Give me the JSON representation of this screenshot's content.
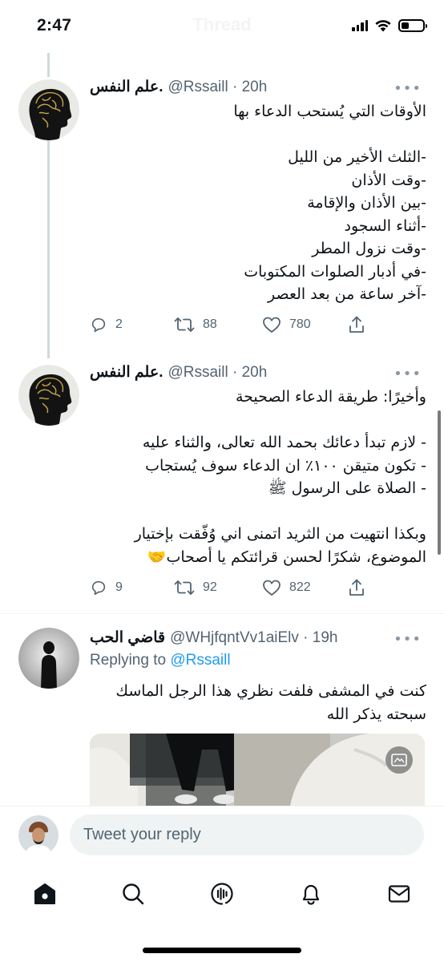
{
  "status_bar": {
    "time": "2:47",
    "ghost_title": "Thread"
  },
  "tweets": [
    {
      "display_name": "علم النفس.",
      "meta": "@Rssaill · 20h",
      "lines": [
        "الأوقات التي يُستحب الدعاء بها",
        "",
        "-الثلث الأخير من الليل",
        "-وقت الأذان",
        "-بين الأذان والإقامة",
        "-أثناء السجود",
        "-وقت نزول المطر",
        "-في أدبار الصلوات المكتوبات",
        "-آخر ساعة من بعد العصر"
      ],
      "replies": "2",
      "retweets": "88",
      "likes": "780"
    },
    {
      "display_name": "علم النفس.",
      "meta": "@Rssaill · 20h",
      "lines": [
        "وأخيرًا: طريقة الدعاء الصحيحة",
        "",
        "- لازم تبدأ دعائك بحمد الله تعالى، والثناء عليه",
        "- تكون متيقن ١٠٠٪ ان الدعاء سوف يُستجاب",
        "- الصلاة على الرسول ﷺ",
        "",
        "وبكذا انتهيت من الثريد اتمنى اني وُفّقت بإختيار",
        "الموضوع، شكرًا لحسن قرائتكم يا أصحاب🤝"
      ],
      "replies": "9",
      "retweets": "92",
      "likes": "822"
    },
    {
      "display_name": "قاضي الحب",
      "meta": "@WHjfqntVv1aiElv · 19h",
      "replying_prefix": "Replying to",
      "replying_handle": "@Rssaill",
      "lines": [
        "كنت في المشفى فلفت نظري هذا الرجل الماسك",
        "سبحته يذكر الله"
      ]
    }
  ],
  "composer": {
    "placeholder": "Tweet your reply"
  },
  "nav": {
    "items": [
      "home-icon",
      "search-icon",
      "spaces-icon",
      "notifications-icon",
      "messages-icon"
    ]
  },
  "colors": {
    "accent": "#1d9bf0",
    "secondary_text": "#536471",
    "thread_line": "#cfd9de"
  }
}
